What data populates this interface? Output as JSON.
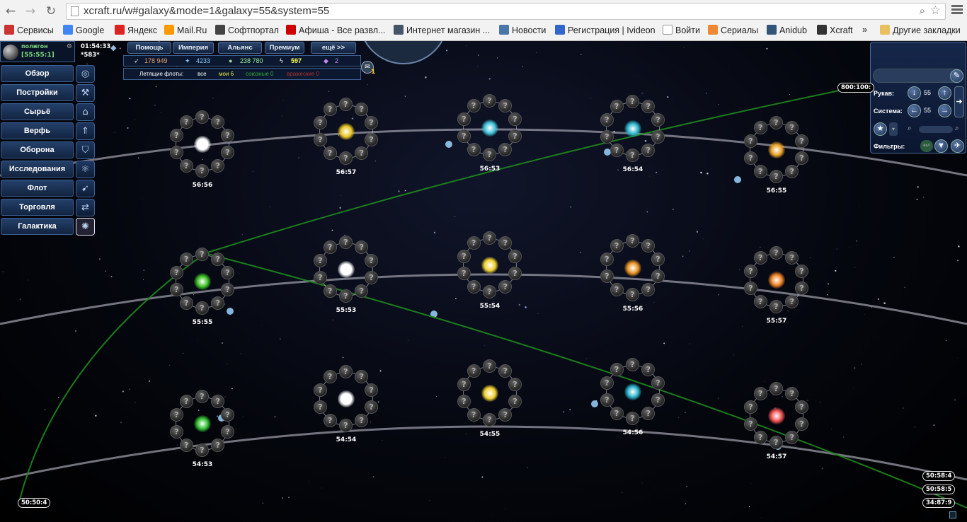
{
  "browser": {
    "url": "xcraft.ru/w#galaxy&mode=1&galaxy=55&system=55",
    "bookmarks": [
      {
        "label": "Сервисы",
        "icon": "apps-icon"
      },
      {
        "label": "Google",
        "icon": "google-icon"
      },
      {
        "label": "Яндекс",
        "icon": "yandex-icon"
      },
      {
        "label": "Mail.Ru",
        "icon": "mailru-icon"
      },
      {
        "label": "Софтпортал",
        "icon": "softportal-icon"
      },
      {
        "label": "Афиша - Все развл...",
        "icon": "afisha-icon"
      },
      {
        "label": "Интернет магазин ...",
        "icon": "shop-icon"
      },
      {
        "label": "Новости",
        "icon": "vk-icon"
      },
      {
        "label": "Регистрация | Ivideon",
        "icon": "ivideon-icon"
      },
      {
        "label": "Войти",
        "icon": "page-icon"
      },
      {
        "label": "Сериалы",
        "icon": "serials-icon"
      },
      {
        "label": "Anidub",
        "icon": "anidub-icon"
      },
      {
        "label": "Xcraft",
        "icon": "xcraft-icon"
      }
    ],
    "more": "»",
    "other_bookmarks": "Другие закладки"
  },
  "player": {
    "name": "полигон",
    "coords": "[55:55:1]"
  },
  "clock": {
    "time": "01:54:33",
    "counter": "*583*"
  },
  "top_menu": [
    "Помощь",
    "Империя",
    "Альянс",
    "Премиум",
    "ещё >>"
  ],
  "resources": {
    "metal": "178 949",
    "crystal": "4233",
    "deuterium": "238 780",
    "energy": "597",
    "dark_matter": "2"
  },
  "fleets": {
    "label": "Летящие флоты:",
    "all": "все",
    "mine": "мои 6",
    "allied": "союзные 0",
    "enemy": "вражеские 0"
  },
  "messages": {
    "count": "1"
  },
  "nav": [
    {
      "label": "Обзор",
      "icon": "planet-icon"
    },
    {
      "label": "Постройки",
      "icon": "build-icon"
    },
    {
      "label": "Сырьё",
      "icon": "factory-icon"
    },
    {
      "label": "Верфь",
      "icon": "rocket-icon"
    },
    {
      "label": "Оборона",
      "icon": "shield-icon"
    },
    {
      "label": "Исследования",
      "icon": "research-icon"
    },
    {
      "label": "Флот",
      "icon": "fleet-icon"
    },
    {
      "label": "Торговля",
      "icon": "trade-icon"
    },
    {
      "label": "Галактика",
      "icon": "galaxy-icon",
      "active": true
    }
  ],
  "panel": {
    "arm_label": "Рукав:",
    "arm_value": "55",
    "system_label": "Система:",
    "system_value": "55",
    "filters_label": "Фильтры:",
    "toggle": "вкл"
  },
  "systems": [
    {
      "label": "56:56",
      "star": "#ffffff",
      "row": 0,
      "col": 0
    },
    {
      "label": "56:57",
      "star": "#e8c420",
      "row": 0,
      "col": 1
    },
    {
      "label": "56:53",
      "star": "#3fc2d8",
      "row": 0,
      "col": 2
    },
    {
      "label": "56:54",
      "star": "#2ab4c8",
      "row": 0,
      "col": 3
    },
    {
      "label": "56:55",
      "star": "#e8a020",
      "row": 0,
      "col": 4
    },
    {
      "label": "55:55",
      "star": "#3ac020",
      "row": 1,
      "col": 0
    },
    {
      "label": "55:53",
      "star": "#ffffff",
      "row": 1,
      "col": 1
    },
    {
      "label": "55:54",
      "star": "#f0d030",
      "row": 1,
      "col": 2
    },
    {
      "label": "55:56",
      "star": "#e89020",
      "row": 1,
      "col": 3
    },
    {
      "label": "55:57",
      "star": "#f08020",
      "row": 1,
      "col": 4
    },
    {
      "label": "54:53",
      "star": "#30c030",
      "row": 2,
      "col": 0
    },
    {
      "label": "54:54",
      "star": "#ffffff",
      "row": 2,
      "col": 1
    },
    {
      "label": "54:55",
      "star": "#f0d030",
      "row": 2,
      "col": 2
    },
    {
      "label": "54:56",
      "star": "#2ab4c8",
      "row": 2,
      "col": 3
    },
    {
      "label": "54:57",
      "star": "#f05050",
      "row": 2,
      "col": 4
    }
  ],
  "coord_badges": {
    "top_right": "800:100:",
    "bottom_left": "50:50:4",
    "br1": "50:58:4",
    "br2": "50:58:5",
    "br3": "34:87:9"
  }
}
